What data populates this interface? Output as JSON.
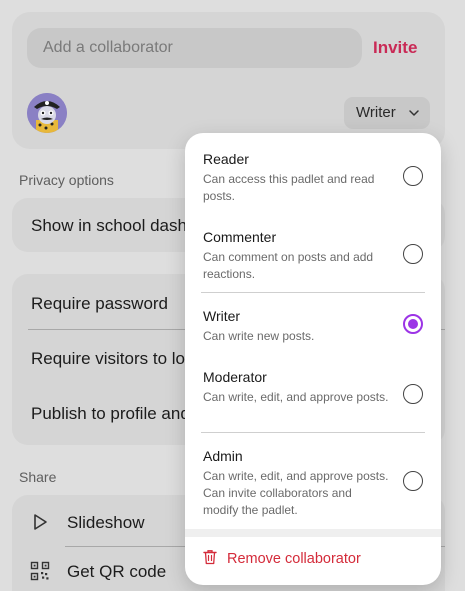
{
  "collaborators": {
    "input_placeholder": "Add a collaborator",
    "invite_label": "Invite",
    "current_role": "Writer"
  },
  "privacy": {
    "section_label": "Privacy options",
    "school_dashboard": "Show in school dashboard",
    "require_password": "Require password",
    "require_login": "Require visitors to log in",
    "publish_profile": "Publish to profile and search"
  },
  "share": {
    "section_label": "Share",
    "slideshow": "Slideshow",
    "qr_code": "Get QR code"
  },
  "role_menu": {
    "options": [
      {
        "title": "Reader",
        "desc": "Can access this padlet and read posts.",
        "selected": false
      },
      {
        "title": "Commenter",
        "desc": "Can comment on posts and add reactions.",
        "selected": false
      },
      {
        "title": "Writer",
        "desc": "Can write new posts.",
        "selected": true
      },
      {
        "title": "Moderator",
        "desc": "Can write, edit, and approve posts.",
        "selected": false
      },
      {
        "title": "Admin",
        "desc": "Can write, edit, and approve posts. Can invite collaborators and modify the padlet.",
        "selected": false
      }
    ],
    "remove_label": "Remove collaborator"
  },
  "colors": {
    "accent_invite": "#c92a56",
    "radio_selected": "#9c34e6",
    "danger": "#d42b3a"
  },
  "icons": [
    "chevron-down-icon",
    "play-icon",
    "qr-code-icon",
    "trash-icon"
  ]
}
